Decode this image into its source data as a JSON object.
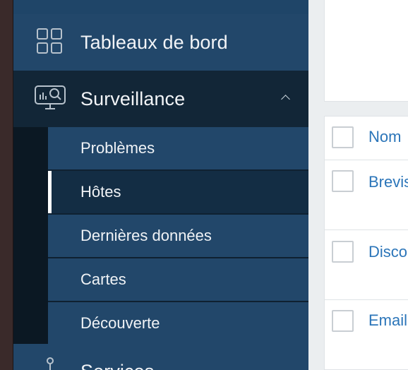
{
  "sidebar": {
    "dashboards_label": "Tableaux de bord",
    "monitoring": {
      "label": "Surveillance",
      "expanded": true,
      "items": [
        {
          "label": "Problèmes",
          "active": false
        },
        {
          "label": "Hôtes",
          "active": true
        },
        {
          "label": "Dernières données",
          "active": false
        },
        {
          "label": "Cartes",
          "active": false
        },
        {
          "label": "Découverte",
          "active": false
        }
      ]
    },
    "services_label": "Services"
  },
  "table": {
    "header": "Nom",
    "rows": [
      {
        "name": "Brevis"
      },
      {
        "name": "Disco"
      },
      {
        "name": "Email"
      }
    ]
  },
  "colors": {
    "sidebar_bg": "#22476a",
    "sidebar_active_bg": "#132d44",
    "link": "#2b75b9"
  }
}
